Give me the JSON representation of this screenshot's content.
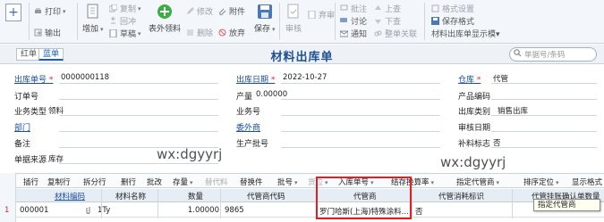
{
  "ribbon": {
    "new_label": "+",
    "print": "打印",
    "export": "输出",
    "copy": "复制",
    "return": "回冲",
    "add": "增加",
    "draft": "草稿",
    "form_select": "表外领料",
    "edit": "修改",
    "delete": "删除",
    "attach": "附件",
    "abandon": "放弃",
    "save": "保存",
    "audit": "审核",
    "discard": "弃审",
    "annotate": "批注",
    "discuss": "讨论",
    "notify": "通知",
    "prev": "上查",
    "next": "下查",
    "assoc": "整单关联",
    "format_setting": "格式设置",
    "save_format": "保存格式",
    "display_template": "材料出库单显示模▾"
  },
  "titlebar": {
    "red_label": "红单",
    "blue_label": "蓝单",
    "title": "材料出库单",
    "search_placeholder": "单据号/条码"
  },
  "form": {
    "order_no_label": "出库单号",
    "order_no": "0000000118",
    "date_label": "出库日期",
    "date": "2022-10-27",
    "warehouse_label": "仓库",
    "warehouse": "代管",
    "order_label": "订单号",
    "qty_label": "产量",
    "qty": "0.00000",
    "product_code_label": "产品编码",
    "biz_type_label": "业务类型",
    "biz_type": "领料",
    "biz_no_label": "业务号",
    "out_category_label": "出库类别",
    "out_category": "销售出库",
    "dept_label": "部门",
    "outsource_label": "委外商",
    "audit_date_label": "审核日期",
    "remark_label": "备注",
    "batch_label": "生产批号",
    "supp_flag_label": "补料标志",
    "supp_flag": "否",
    "source_label": "单据来源",
    "source": "库存"
  },
  "watermarks": {
    "wm1": "wx:dgyyrj",
    "wm2": "wx:dgyyrj"
  },
  "gridbar": {
    "insert": "插行",
    "copy_row": "复制行",
    "split_row": "拆分行",
    "delete_row": "删行",
    "batch_change": "批改",
    "stock": "存量",
    "substitute": "替代料",
    "replace": "替换件",
    "batch_no": "批号",
    "cargo": "货位",
    "inbound_no": "入库单号",
    "settle_calc": "结存换算率",
    "assign_agent": "指定代管商",
    "sort_locate": "排序定位",
    "display_format": "显示格式"
  },
  "grid": {
    "columns": [
      "材料编码",
      "材料名称",
      "数量",
      "代管商代码",
      "代管商",
      "代管消耗标识",
      "代管挂账确认单数量"
    ],
    "rows": [
      {
        "row_no": "1",
        "code": "000001",
        "name": "1Ty",
        "qty": "1.00000",
        "agent_code": "9865",
        "agent": "罗门哈斯(上海)特殊涂料...",
        "consume_flag": "否",
        "confirm_qty": ""
      }
    ]
  },
  "tooltip": "指定代管商"
}
